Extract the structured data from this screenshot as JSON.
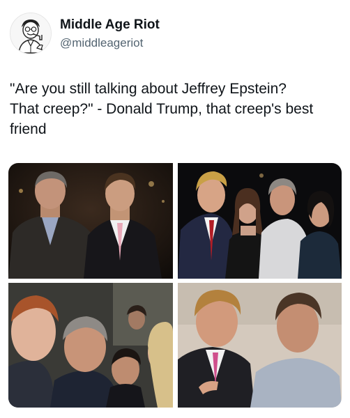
{
  "author": {
    "display_name": "Middle Age Riot",
    "handle": "@middleageriot",
    "avatar_icon": "cartoon-man-with-pipe-avatar"
  },
  "tweet": {
    "text": "\"Are you still talking about Jeffrey Epstein?\nThat creep?\" - Donald Trump, that creep's best\nfriend"
  },
  "media": {
    "photos": [
      {
        "name": "two-men-in-suits-at-party-photo"
      },
      {
        "name": "four-people-posing-at-event-photo"
      },
      {
        "name": "crowd-close-up-photo"
      },
      {
        "name": "two-men-talking-photo"
      }
    ]
  },
  "colors": {
    "text_primary": "#0f1419",
    "text_secondary": "#536471",
    "background": "#ffffff"
  }
}
